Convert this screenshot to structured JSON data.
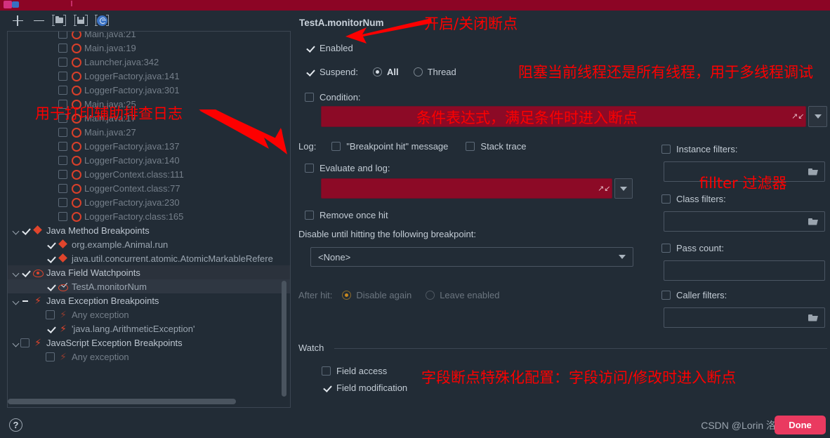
{
  "window": {
    "top_band_color": "#8c0525",
    "background": "#222c36"
  },
  "toolbar": {
    "add_label": "+",
    "remove_label": "−",
    "group_label": "folder-group",
    "save_label": "save-to-file",
    "mute_label": "mute-breakpoints"
  },
  "tree": {
    "items": [
      {
        "indent": 3,
        "arrow": "none",
        "check": "off",
        "icon": "bp-circle",
        "label": "Main.java:21",
        "dim": true,
        "cut": true
      },
      {
        "indent": 3,
        "arrow": "none",
        "check": "off",
        "icon": "bp-circle",
        "label": "Main.java:19",
        "dim": true
      },
      {
        "indent": 3,
        "arrow": "none",
        "check": "off",
        "icon": "bp-circle",
        "label": "Launcher.java:342",
        "dim": true
      },
      {
        "indent": 3,
        "arrow": "none",
        "check": "off",
        "icon": "bp-circle",
        "label": "LoggerFactory.java:141",
        "dim": true
      },
      {
        "indent": 3,
        "arrow": "none",
        "check": "off",
        "icon": "bp-circle",
        "label": "LoggerFactory.java:301",
        "dim": true
      },
      {
        "indent": 3,
        "arrow": "none",
        "check": "off",
        "icon": "bp-circle",
        "label": "Main.java:25",
        "dim": true
      },
      {
        "indent": 3,
        "arrow": "none",
        "check": "off",
        "icon": "bp-circle",
        "label": "Main.java:17",
        "dim": true
      },
      {
        "indent": 3,
        "arrow": "none",
        "check": "off",
        "icon": "bp-circle",
        "label": "Main.java:27",
        "dim": true
      },
      {
        "indent": 3,
        "arrow": "none",
        "check": "off",
        "icon": "bp-circle",
        "label": "LoggerFactory.java:137",
        "dim": true
      },
      {
        "indent": 3,
        "arrow": "none",
        "check": "off",
        "icon": "bp-circle",
        "label": "LoggerFactory.java:140",
        "dim": true
      },
      {
        "indent": 3,
        "arrow": "none",
        "check": "off",
        "icon": "bp-circle",
        "label": "LoggerContext.class:111",
        "dim": true
      },
      {
        "indent": 3,
        "arrow": "none",
        "check": "off",
        "icon": "bp-circle",
        "label": "LoggerContext.class:77",
        "dim": true
      },
      {
        "indent": 3,
        "arrow": "none",
        "check": "off",
        "icon": "bp-circle",
        "label": "LoggerFactory.java:230",
        "dim": true
      },
      {
        "indent": 3,
        "arrow": "none",
        "check": "off",
        "icon": "bp-circle",
        "label": "LoggerFactory.class:165",
        "dim": true
      },
      {
        "indent": 0,
        "arrow": "open",
        "check": "on",
        "icon": "bp-method",
        "label": "Java Method Breakpoints",
        "group": true
      },
      {
        "indent": 2,
        "arrow": "none",
        "check": "on",
        "icon": "bp-method",
        "label": "org.example.Animal.run"
      },
      {
        "indent": 2,
        "arrow": "none",
        "check": "on",
        "icon": "bp-method",
        "label": "java.util.concurrent.atomic.AtomicMarkableRefere"
      },
      {
        "indent": 0,
        "arrow": "open",
        "check": "on",
        "icon": "bp-eye",
        "label": "Java Field Watchpoints",
        "group": true,
        "highlight": "dark"
      },
      {
        "indent": 2,
        "arrow": "none",
        "check": "on",
        "icon": "bp-eye-chk",
        "label": "TestA.monitorNum",
        "highlight": "sel"
      },
      {
        "indent": 0,
        "arrow": "open",
        "check": "partial",
        "icon": "bp-bolt",
        "label": "Java Exception Breakpoints",
        "group": true
      },
      {
        "indent": 2,
        "arrow": "none",
        "check": "off",
        "icon": "bp-bolt-dim",
        "label": "Any exception",
        "dim": true
      },
      {
        "indent": 2,
        "arrow": "none",
        "check": "on",
        "icon": "bp-bolt",
        "label": "'java.lang.ArithmeticException'"
      },
      {
        "indent": 0,
        "arrow": "open",
        "check": "off",
        "icon": "bp-bolt",
        "label": "JavaScript Exception Breakpoints",
        "group": true
      },
      {
        "indent": 2,
        "arrow": "none",
        "check": "off",
        "icon": "bp-bolt-dim",
        "label": "Any exception",
        "dim": true,
        "cut": true
      }
    ]
  },
  "detail": {
    "title": "TestA.monitorNum",
    "enabled": {
      "label": "Enabled",
      "checked": true
    },
    "suspend": {
      "label": "Suspend:",
      "checked": true,
      "options": [
        {
          "label": "All",
          "selected": true
        },
        {
          "label": "Thread",
          "selected": false
        }
      ]
    },
    "condition": {
      "label": "Condition:",
      "checked": false,
      "value": ""
    },
    "log": {
      "label": "Log:",
      "breakpoint_hit": {
        "label": "\"Breakpoint hit\" message",
        "checked": false
      },
      "stack_trace": {
        "label": "Stack trace",
        "checked": false
      }
    },
    "evaluate_and_log": {
      "label": "Evaluate and log:",
      "checked": false,
      "value": ""
    },
    "remove_once_hit": {
      "label": "Remove once hit",
      "checked": false
    },
    "disable_until": {
      "label": "Disable until hitting the following breakpoint:",
      "selected": "<None>",
      "after_hit_label": "After hit:",
      "after_hit_options": [
        {
          "label": "Disable again",
          "selected": true
        },
        {
          "label": "Leave enabled",
          "selected": false
        }
      ]
    },
    "filters": {
      "instance": {
        "label": "Instance filters:",
        "checked": false,
        "value": ""
      },
      "class": {
        "label": "Class filters:",
        "checked": false,
        "value": ""
      },
      "pass_count": {
        "label": "Pass count:",
        "checked": false,
        "value": ""
      },
      "caller": {
        "label": "Caller filters:",
        "checked": false,
        "value": ""
      }
    },
    "watch": {
      "title": "Watch",
      "field_access": {
        "label": "Field access",
        "checked": false
      },
      "field_modification": {
        "label": "Field modification",
        "checked": true
      }
    }
  },
  "annotations": {
    "color": "#fd0000",
    "toggle_breakpoint": "开启/关闭断点",
    "suspend_threads": "阻塞当前线程还是所有线程，用于多线程调试",
    "condition_expression": "条件表达式，满足条件时进入断点",
    "logging_help": "用于打印辅助排查日志",
    "filter_label": "fillter 过滤器",
    "field_breakpoint": "字段断点特殊化配置：字段访问/修改时进入断点"
  },
  "footer": {
    "help_label": "?",
    "watermark": "CSDN @Lorin 洛林",
    "done_label": "Done",
    "done_color": "#ea3a60"
  }
}
